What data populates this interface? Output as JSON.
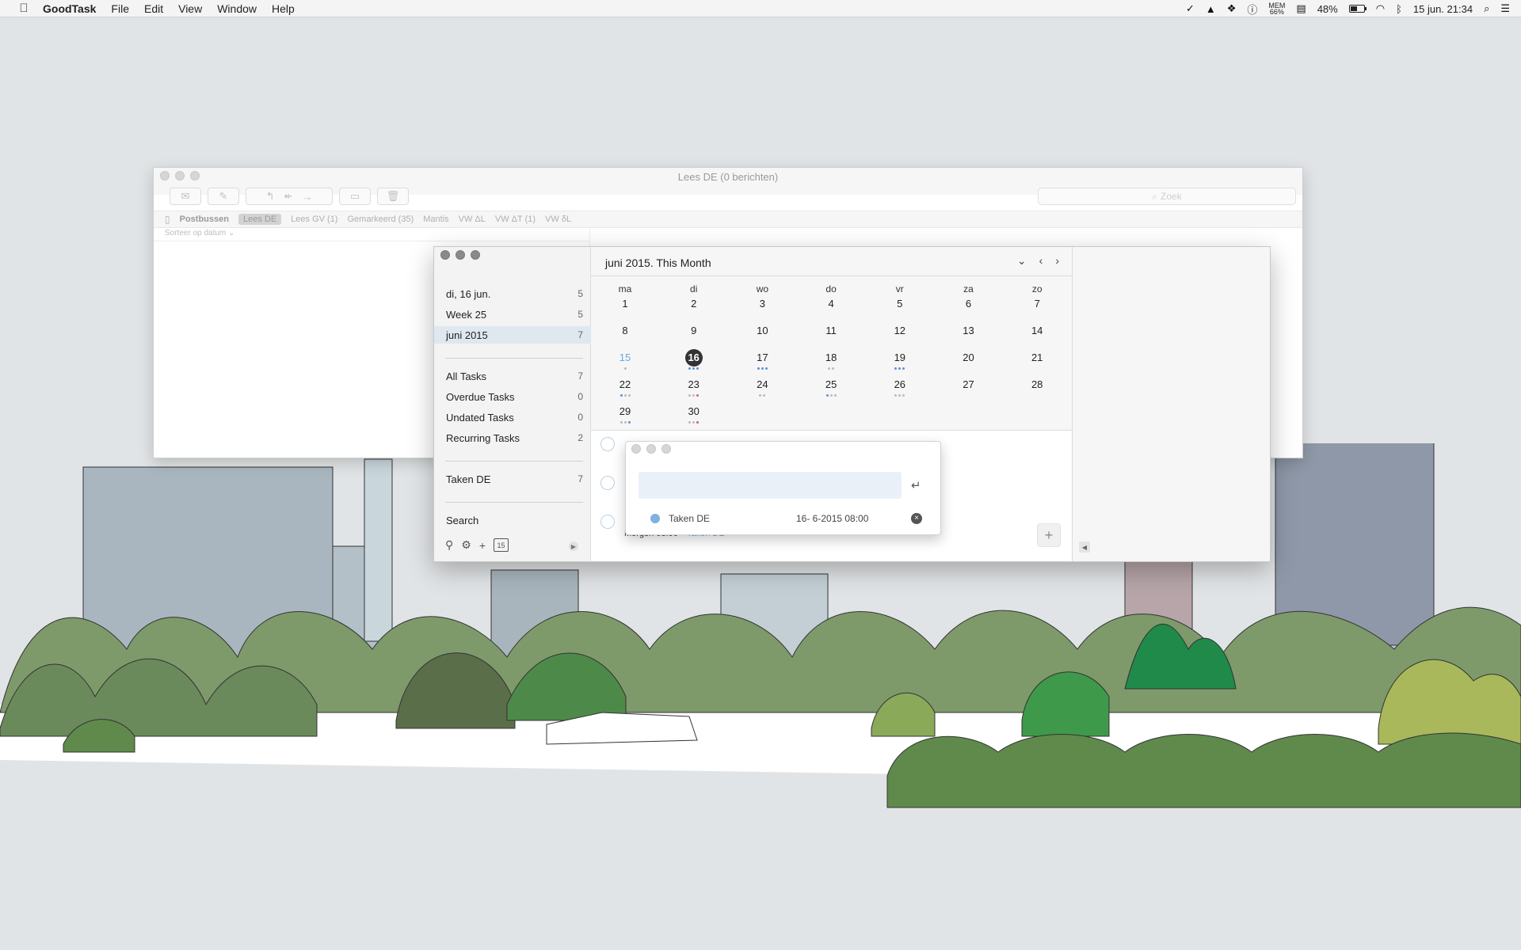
{
  "menubar": {
    "apple": "",
    "app": "GoodTask",
    "menus": [
      "File",
      "Edit",
      "View",
      "Window",
      "Help"
    ],
    "mem_label": "MEM",
    "mem_value": "66%",
    "battery": "48%",
    "battery_level": 0.48,
    "clock": "15 jun. 21:34"
  },
  "mail": {
    "title": "Lees DE (0 berichten)",
    "search_placeholder": "Zoek",
    "favorites": [
      "Postbussen",
      "Lees DE",
      "Lees GV (1)",
      "Gemarkeerd (35)",
      "Mantis",
      "VW ΔL",
      "VW ΔT (1)",
      "VW δL"
    ],
    "sort_label": "Sorteer op datum"
  },
  "sidebar": {
    "items": [
      {
        "label": "di, 16 jun.",
        "count": "5"
      },
      {
        "label": "Week 25",
        "count": "5"
      },
      {
        "label": "juni 2015",
        "count": "7"
      },
      {
        "label": "All Tasks",
        "count": "7"
      },
      {
        "label": "Overdue Tasks",
        "count": "0"
      },
      {
        "label": "Undated Tasks",
        "count": "0"
      },
      {
        "label": "Recurring Tasks",
        "count": "2"
      },
      {
        "label": "Taken DE",
        "count": "7"
      },
      {
        "label": "Search",
        "count": ""
      }
    ],
    "calendar_tool": "15"
  },
  "calendar": {
    "title": "juni 2015. This Month",
    "weekdays": [
      "ma",
      "di",
      "wo",
      "do",
      "vr",
      "za",
      "zo"
    ],
    "days": [
      "1",
      "2",
      "3",
      "4",
      "5",
      "6",
      "7",
      "8",
      "9",
      "10",
      "11",
      "12",
      "13",
      "14",
      "15",
      "16",
      "17",
      "18",
      "19",
      "20",
      "21",
      "22",
      "23",
      "24",
      "25",
      "26",
      "27",
      "28",
      "29",
      "30"
    ]
  },
  "tasks": {
    "subtitle_time": "Morgen 08:00",
    "subtitle_list": "Taken DE",
    "add": "+"
  },
  "quick_entry": {
    "enter_icon": "↵",
    "list": "Taken DE",
    "date": "16-  6-2015 08:00",
    "clear": "×"
  }
}
